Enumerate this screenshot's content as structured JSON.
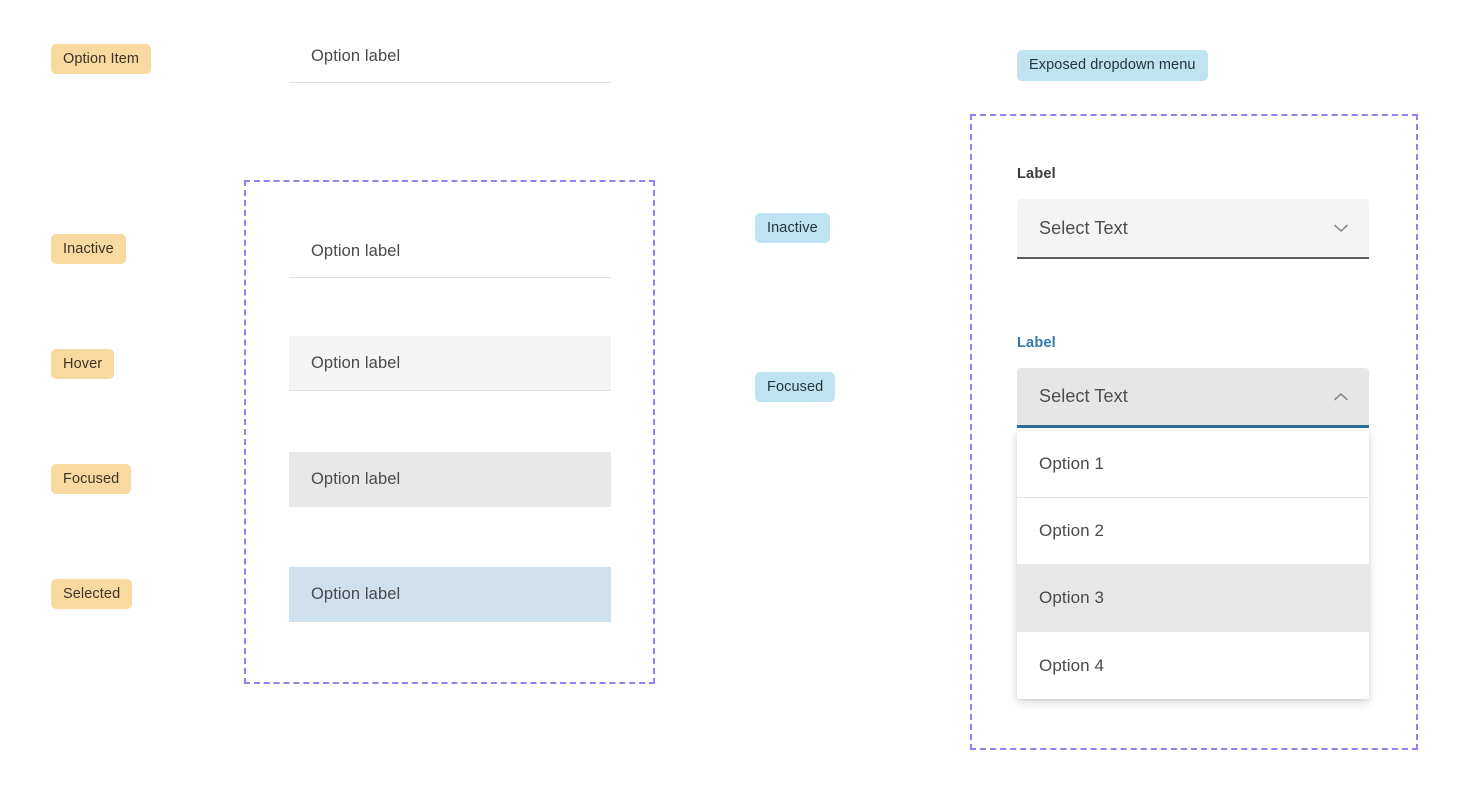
{
  "left_column": {
    "state_labels": [
      {
        "text": "Option Item"
      },
      {
        "text": "Inactive"
      },
      {
        "text": "Hover"
      },
      {
        "text": "Focused"
      },
      {
        "text": "Selected"
      }
    ]
  },
  "option_item_preview": {
    "label": "Option label"
  },
  "option_list": {
    "rows": [
      {
        "label": "Option label",
        "state": "inactive"
      },
      {
        "label": "Option label",
        "state": "hover"
      },
      {
        "label": "Option label",
        "state": "focused"
      },
      {
        "label": "Option label",
        "state": "selected"
      }
    ]
  },
  "middle_column": {
    "state_labels": [
      {
        "text": "Inactive"
      },
      {
        "text": "Focused"
      }
    ]
  },
  "dropdown_section": {
    "title_badge": "Exposed dropdown menu",
    "inactive_select": {
      "label": "Label",
      "value": "Select Text",
      "icon": "chevron-down-icon"
    },
    "focused_select": {
      "label": "Label",
      "value": "Select Text",
      "icon": "chevron-up-icon"
    },
    "menu_options": [
      {
        "label": "Option 1",
        "state": "default"
      },
      {
        "label": "Option 2",
        "state": "default"
      },
      {
        "label": "Option 3",
        "state": "hover"
      },
      {
        "label": "Option 4",
        "state": "default"
      }
    ]
  },
  "colors": {
    "badge_tan": "#f8d9a0",
    "badge_blue": "#bfe3f1",
    "dashed_border": "#8f81f2",
    "selected_row": "#cfe0ef",
    "hover_row": "#f4f4f4",
    "focused_row": "#e7e7e7",
    "focus_underline": "#2c6f97",
    "focused_label": "#2f7aa9",
    "inactive_underline": "#5c5c5c"
  }
}
